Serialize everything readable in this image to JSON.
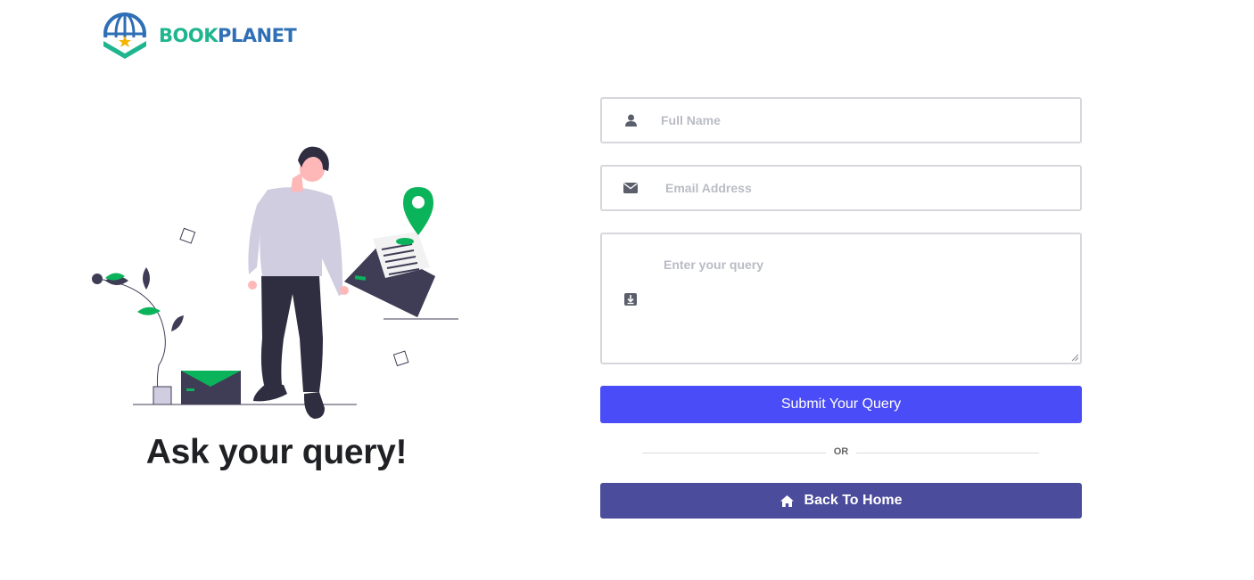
{
  "brand": {
    "name_part1": "BOOK",
    "name_part2": "PLANET"
  },
  "hero": {
    "heading": "Ask your query!"
  },
  "form": {
    "full_name": {
      "placeholder": "Full Name",
      "value": "",
      "icon": "user-icon"
    },
    "email": {
      "placeholder": "Email Address",
      "value": "",
      "icon": "envelope-icon"
    },
    "query": {
      "placeholder": "Enter your query",
      "value": "",
      "icon": "download-icon"
    },
    "submit_label": "Submit Your Query"
  },
  "divider": {
    "text": "OR"
  },
  "home_button": {
    "label": "Back To Home",
    "icon": "home-icon"
  },
  "colors": {
    "primary": "#4a4cf7",
    "secondary": "#4b4c9c",
    "accent_green": "#1fb58f",
    "brand_blue": "#2f6fb5"
  }
}
